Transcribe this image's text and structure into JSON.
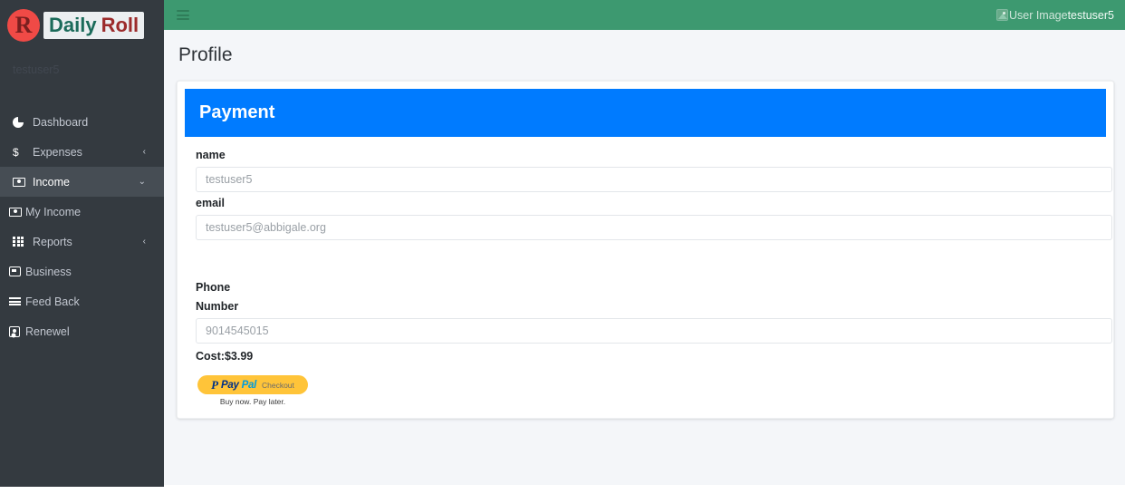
{
  "brand": {
    "mark_letter": "R",
    "name_part1": "Daily",
    "name_part2": "Roll"
  },
  "sidebar": {
    "username": "testuser5",
    "items": [
      {
        "label": "Dashboard",
        "icon": "pie-chart-icon",
        "arrow": "",
        "active": false
      },
      {
        "label": "Expenses",
        "icon": "dollar-icon",
        "arrow": "‹",
        "active": false
      },
      {
        "label": "Income",
        "icon": "money-icon",
        "arrow": "⌄",
        "active": true
      },
      {
        "label": "My Income",
        "icon": "money-icon",
        "arrow": "",
        "active": false
      },
      {
        "label": "Reports",
        "icon": "grid-icon",
        "arrow": "‹",
        "active": false
      },
      {
        "label": "Business",
        "icon": "card-icon",
        "arrow": "",
        "active": false
      },
      {
        "label": "Feed Back",
        "icon": "bars-icon",
        "arrow": "",
        "active": false
      },
      {
        "label": "Renewel",
        "icon": "id-card-icon",
        "arrow": "",
        "active": false
      }
    ]
  },
  "topbar": {
    "menu_icon": "hamburger-icon",
    "avatar_alt": "User Image",
    "username": "testuser5"
  },
  "page": {
    "title": "Profile"
  },
  "card": {
    "header_title": "Payment",
    "fields": [
      {
        "label": "name",
        "value": "testuser5"
      },
      {
        "label": "email",
        "value": "testuser5@abbigale.org"
      }
    ],
    "phone_label_line1": "Phone",
    "phone_label_line2": "Number",
    "phone_value": "9014545015",
    "cost": "Cost:$3.99",
    "paypal": {
      "glyph": "P",
      "pay": "Pay",
      "pal": "Pal",
      "checkout": "Checkout",
      "note": "Buy now. Pay later."
    }
  },
  "colors": {
    "header_green": "#3d9970",
    "sidebar_dark": "#343a40",
    "card_header_blue": "#007bff",
    "paypal_yellow": "#ffc439",
    "page_bg": "#f4f6f9"
  }
}
